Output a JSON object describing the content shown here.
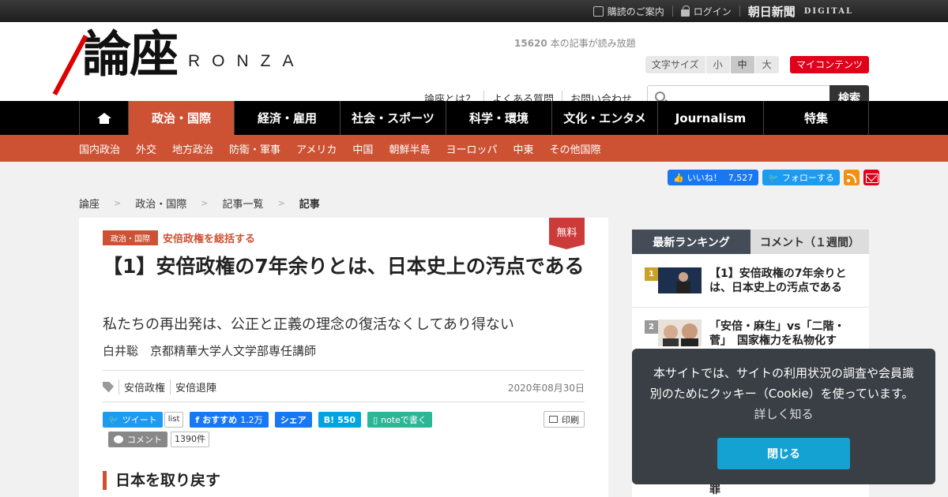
{
  "topbar": {
    "subscribe": "購読のご案内",
    "login": "ログイン",
    "brand": "朝日新聞",
    "brand_sub": "DIGITAL"
  },
  "header": {
    "logo_kanji": "論座",
    "logo_latin": "RONZA",
    "read_count": "15620",
    "read_count_suffix": " 本の記事が読み放題",
    "font_size_label": "文字サイズ",
    "font_sizes": [
      "小",
      "中",
      "大"
    ],
    "font_size_selected": "中",
    "my_contents": "マイコンテンツ",
    "help_links": [
      "論座とは？",
      "よくある質問",
      "お問い合わせ"
    ],
    "search_placeholder": "",
    "search_button": "検索"
  },
  "nav": {
    "items": [
      "政治・国際",
      "経済・雇用",
      "社会・スポーツ",
      "科学・環境",
      "文化・エンタメ",
      "Journalism",
      "特集"
    ],
    "active": "政治・国際"
  },
  "subnav": {
    "items": [
      "国内政治",
      "外交",
      "地方政治",
      "防衛・軍事",
      "アメリカ",
      "中国",
      "朝鮮半島",
      "ヨーロッパ",
      "中東",
      "その他国際"
    ]
  },
  "social": {
    "fb_like": "いいね！",
    "fb_count": "7,527",
    "tw_follow": "フォローする"
  },
  "breadcrumb": [
    "論座",
    "政治・国際",
    "記事一覧",
    "記事"
  ],
  "article": {
    "free_badge": "無料",
    "category": "政治・国際",
    "series": "安倍政権を総括する",
    "title": "【1】安倍政権の7年余りとは、日本史上の汚点である",
    "subtitle": "私たちの再出発は、公正と正義の理念の復活なくしてあり得ない",
    "author": "白井聡　京都精華大学人文学部専任講師",
    "tags": [
      "安倍政権",
      "安倍退陣"
    ],
    "date": "2020年08月30日",
    "share": {
      "tweet": "ツイート",
      "list": "list",
      "fb_recommend": "おすすめ",
      "fb_count": "1.2万",
      "fb_share": "シェア",
      "hatena": "B!",
      "hatena_count": "550",
      "note": "noteで書く",
      "print": "印刷",
      "comment": "コメント",
      "comment_count": "1390件"
    },
    "section_heading": "日本を取り戻す"
  },
  "sidebar": {
    "tabs": [
      "最新ランキング",
      "コメント（１週間）"
    ],
    "active_tab": "最新ランキング",
    "ranking": [
      {
        "rank": "1",
        "title": "【1】安倍政権の7年余りとは、日本史上の汚点である",
        "badge_color": "#c9a227"
      },
      {
        "rank": "2",
        "title": "「安倍・麻生」vs「二階・菅」　国家権力を私物化す",
        "badge_color": "#9a9a9a"
      }
    ],
    "cut_text": "罪"
  },
  "cookie": {
    "text": "本サイトでは、サイトの利用状況の調査や会員識別のためにクッキー（Cookie）を使っています。",
    "more": "詳しく知る",
    "close": "閉じる"
  }
}
